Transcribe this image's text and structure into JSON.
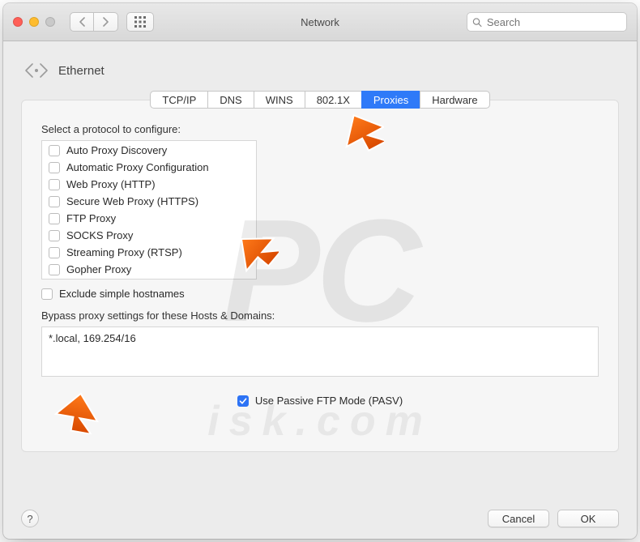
{
  "window": {
    "title": "Network",
    "search_placeholder": "Search"
  },
  "pane": {
    "title": "Ethernet"
  },
  "tabs": [
    {
      "label": "TCP/IP",
      "selected": false
    },
    {
      "label": "DNS",
      "selected": false
    },
    {
      "label": "WINS",
      "selected": false
    },
    {
      "label": "802.1X",
      "selected": false
    },
    {
      "label": "Proxies",
      "selected": true
    },
    {
      "label": "Hardware",
      "selected": false
    }
  ],
  "proxy_panel": {
    "select_label": "Select a protocol to configure:",
    "protocols": [
      {
        "label": "Auto Proxy Discovery",
        "checked": false
      },
      {
        "label": "Automatic Proxy Configuration",
        "checked": false
      },
      {
        "label": "Web Proxy (HTTP)",
        "checked": false
      },
      {
        "label": "Secure Web Proxy (HTTPS)",
        "checked": false
      },
      {
        "label": "FTP Proxy",
        "checked": false
      },
      {
        "label": "SOCKS Proxy",
        "checked": false
      },
      {
        "label": "Streaming Proxy (RTSP)",
        "checked": false
      },
      {
        "label": "Gopher Proxy",
        "checked": false
      }
    ],
    "exclude_simple_label": "Exclude simple hostnames",
    "exclude_simple_checked": false,
    "bypass_label": "Bypass proxy settings for these Hosts & Domains:",
    "bypass_value": "*.local, 169.254/16",
    "pasv_label": "Use Passive FTP Mode (PASV)",
    "pasv_checked": true
  },
  "footer": {
    "help": "?",
    "cancel": "Cancel",
    "ok": "OK"
  }
}
